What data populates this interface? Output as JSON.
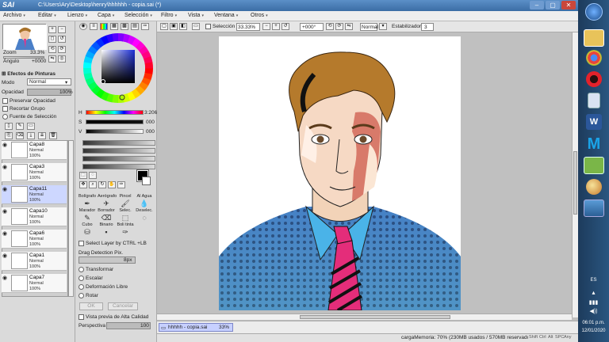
{
  "titlebar": {
    "app": "SAI",
    "title": "C:\\Users\\Ary\\Desktop\\henry\\hhhhhh - copia.sai (*)",
    "min": "–",
    "max": "▢",
    "close": "✕"
  },
  "menu": [
    "Archivo",
    "Editar",
    "Lienzo",
    "Capa",
    "Selección",
    "Filtro",
    "Vista",
    "Ventana",
    "Otros"
  ],
  "nav": {
    "zoom_label": "Zoom",
    "zoom_value": "33.3%",
    "angle_label": "Ángulo",
    "angle_value": "+0000"
  },
  "effects": {
    "header": "Efectos de Pinturas",
    "mode_label": "Modo",
    "mode_value": "Normal",
    "opacity_label": "Opacidad",
    "opacity_value": "100%",
    "preserve": "Preservar Opacidad",
    "clip": "Recortar Grupo",
    "selection_source": "Fuente de Selección"
  },
  "layers": [
    {
      "name": "Capa8",
      "mode": "Normal",
      "opacity": "100%",
      "selected": false
    },
    {
      "name": "Capa3",
      "mode": "Normal",
      "opacity": "100%",
      "selected": false
    },
    {
      "name": "Capa11",
      "mode": "Normal",
      "opacity": "100%",
      "selected": true
    },
    {
      "name": "Capa10",
      "mode": "Normal",
      "opacity": "100%",
      "selected": false
    },
    {
      "name": "Capa6",
      "mode": "Normal",
      "opacity": "100%",
      "selected": false
    },
    {
      "name": "Capa1",
      "mode": "Normal",
      "opacity": "100%",
      "selected": false
    },
    {
      "name": "Capa7",
      "mode": "Normal",
      "opacity": "100%",
      "selected": false
    }
  ],
  "color": {
    "h_label": "H",
    "h_value": "3:206",
    "s_label": "S",
    "s_value": "000",
    "v_label": "V",
    "v_value": "000"
  },
  "tools": {
    "row1": [
      "Bolígrafo",
      "Aerógrafo",
      "Pincel",
      "Al Agua"
    ],
    "row2": [
      "Marador",
      "Borrador",
      "Selec.",
      "Deselec."
    ],
    "row3": [
      "Cubo",
      "Binario",
      "Boli tinta",
      ""
    ]
  },
  "toolopts": {
    "select_layer": "Select Layer by CTRL +LB",
    "drag_label": "Drag Detection Pix.",
    "drag_value": "8px",
    "transform": "Transformar",
    "scale": "Escalar",
    "free_deform": "Deformación Libre",
    "rotate": "Rotar",
    "ok": "OK",
    "cancel": "Cancelar",
    "preview": "Vista previa de Alta Calidad",
    "perspective_label": "Perspectiva",
    "perspective_value": "100"
  },
  "canvas_toolbar": {
    "selection": "Selección",
    "zoom": "33.33%",
    "angle": "+000°",
    "mode": "Normal",
    "stabilizer_label": "Estabilizador",
    "stabilizer_value": "3"
  },
  "status": {
    "tab": "hhhhh - copia.sai",
    "tab_zoom": "33%",
    "memory": "cargaMemoria: 70% (230MB usados / 570MB reservados)",
    "keys": [
      "Shift",
      "Ctrl",
      "Alt",
      "SPC",
      "Any"
    ]
  },
  "taskbar": {
    "lang": "ES",
    "time": "06:01 p.m.",
    "date": "12/01/2020"
  }
}
